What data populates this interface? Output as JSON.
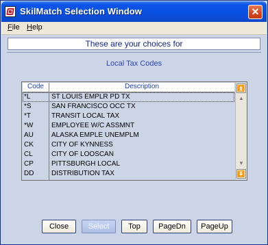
{
  "window": {
    "title": "SkilMatch Selection Window",
    "close_symbol": "✕"
  },
  "menu": {
    "items": [
      {
        "accel": "F",
        "rest": "ile"
      },
      {
        "accel": "H",
        "rest": "elp"
      }
    ]
  },
  "header": {
    "choices_text": "These are your choices for"
  },
  "subtitle": "Local Tax Codes",
  "list": {
    "columns": [
      "Code",
      "Description"
    ],
    "rows": [
      {
        "code": "*L",
        "description": "ST LOUIS EMPLR PD TX"
      },
      {
        "code": "*S",
        "description": "SAN FRANCISCO OCC TX"
      },
      {
        "code": "*T",
        "description": "TRANSIT LOCAL TAX"
      },
      {
        "code": "*W",
        "description": "EMPLOYEE W/C ASSMNT"
      },
      {
        "code": "AU",
        "description": "ALASKA EMPLE UNEMPLM"
      },
      {
        "code": "CK",
        "description": "CITY OF KYNNESS"
      },
      {
        "code": "CL",
        "description": "CITY OF LOOSCAN"
      },
      {
        "code": "CP",
        "description": "PITTSBURGH LOCAL"
      },
      {
        "code": "DD",
        "description": "DISTRIBUTION TAX"
      }
    ],
    "selected_index": 0
  },
  "scrollbar": {
    "top_symbol": "⏫",
    "bottom_symbol": "⏬",
    "up_symbol": "▲",
    "down_symbol": "▼"
  },
  "buttons": {
    "close": "Close",
    "select": "Select",
    "top": "Top",
    "page_down": "PageDn",
    "page_up": "PageUp"
  },
  "colors": {
    "title_bar": "#0a4fe0",
    "window_bg": "#ccd5e6",
    "header_text": "#0a1e8c",
    "subtitle_text": "#2a46b4",
    "column_header_text": "#1a3cc0"
  }
}
